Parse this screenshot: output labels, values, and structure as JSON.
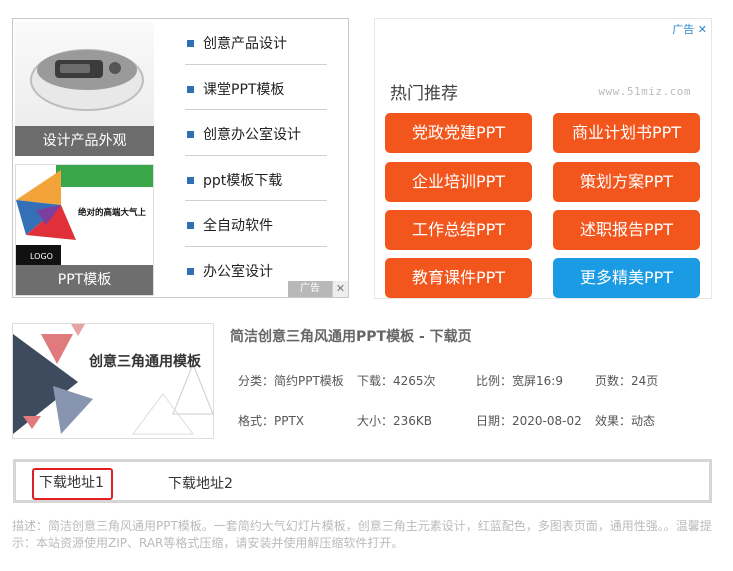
{
  "left_ad": {
    "thumb1_caption": "设计产品外观",
    "thumb2_caption": "PPT模板",
    "thumb2_banner": "绝对的高端大气上",
    "thumb2_logo": "LOGO",
    "items": [
      {
        "label": "创意产品设计"
      },
      {
        "label": "课堂PPT模板"
      },
      {
        "label": "创意办公室设计"
      },
      {
        "label": "ppt模板下载"
      },
      {
        "label": "全自动软件"
      },
      {
        "label": "办公室设计"
      }
    ],
    "ad_badge": "广告",
    "close_glyph": "✕"
  },
  "right_ad": {
    "corner_label": "广告",
    "corner_close": "✕",
    "title": "热门推荐",
    "site": "www.51miz.com",
    "buttons": [
      {
        "label": "党政党建PPT",
        "color": "#f3561d"
      },
      {
        "label": "商业计划书PPT",
        "color": "#f3561d"
      },
      {
        "label": "企业培训PPT",
        "color": "#f3561d"
      },
      {
        "label": "策划方案PPT",
        "color": "#f3561d"
      },
      {
        "label": "工作总结PPT",
        "color": "#f3561d"
      },
      {
        "label": "述职报告PPT",
        "color": "#f3561d"
      },
      {
        "label": "教育课件PPT",
        "color": "#f3561d"
      },
      {
        "label": "更多精美PPT",
        "color": "#1b9be3"
      }
    ]
  },
  "document": {
    "cover_title": "创意三角通用模板",
    "title": "简洁创意三角风通用PPT模板 - 下载页",
    "meta": {
      "category": "分类：简约PPT模板",
      "downloads": "下载：4265次",
      "ratio": "比例：宽屏16:9",
      "pages": "页数：24页",
      "format": "格式：PPTX",
      "size": "大小：236KB",
      "date": "日期：2020-08-02",
      "effect": "效果：动态"
    }
  },
  "downloads": {
    "link1": "下载地址1",
    "link2": "下载地址2"
  },
  "description": "描述：简洁创意三角风通用PPT模板。一套简约大气幻灯片模板，创意三角主元素设计，红蓝配色，多图表页面，通用性强。。温馨提示：本站资源使用ZIP、RAR等格式压缩，请安装并使用解压缩软件打开。"
}
